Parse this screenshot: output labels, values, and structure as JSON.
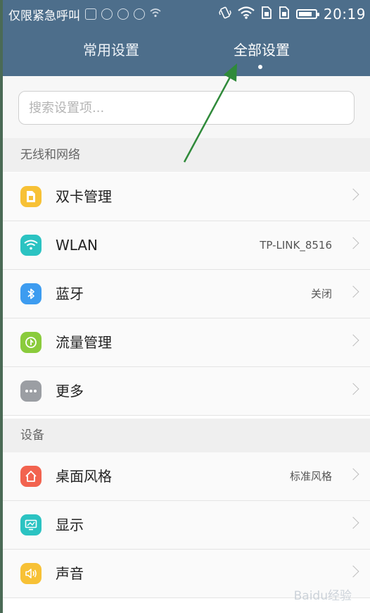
{
  "status_bar": {
    "carrier_text": "仅限紧急呼叫",
    "time": "20:19",
    "icons": [
      "image-icon",
      "robot-icon",
      "cloud-icon",
      "robot-icon",
      "wifi-icon",
      "vibrate-icon",
      "wifi-icon",
      "sim-icon",
      "sim-icon",
      "battery-icon"
    ]
  },
  "tabs": [
    {
      "label": "常用设置",
      "active": false
    },
    {
      "label": "全部设置",
      "active": true
    }
  ],
  "search": {
    "placeholder": "搜索设置项..."
  },
  "sections": [
    {
      "title": "无线和网络",
      "items": [
        {
          "label": "双卡管理",
          "value": "",
          "icon": "sim-card-icon",
          "color": "#f7c136"
        },
        {
          "label": "WLAN",
          "value": "TP-LINK_8516",
          "icon": "wifi-icon",
          "color": "#2bc3c2"
        },
        {
          "label": "蓝牙",
          "value": "关闭",
          "icon": "bluetooth-icon",
          "color": "#3d9cf0"
        },
        {
          "label": "流量管理",
          "value": "",
          "icon": "data-usage-icon",
          "color": "#8acb3c"
        },
        {
          "label": "更多",
          "value": "",
          "icon": "more-icon",
          "color": "#9b9ea3"
        }
      ]
    },
    {
      "title": "设备",
      "items": [
        {
          "label": "桌面风格",
          "value": "标准风格",
          "icon": "home-icon",
          "color": "#f2634f"
        },
        {
          "label": "显示",
          "value": "",
          "icon": "display-icon",
          "color": "#2bc3c2"
        },
        {
          "label": "声音",
          "value": "",
          "icon": "sound-icon",
          "color": "#f7c136"
        }
      ]
    }
  ],
  "watermark": "Baidu经验"
}
